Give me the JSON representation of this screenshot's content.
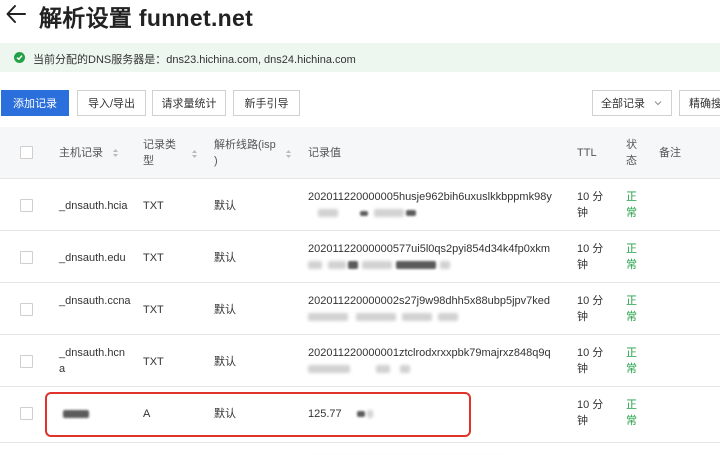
{
  "header": {
    "title": "解析设置 funnet.net"
  },
  "notice": {
    "text": "当前分配的DNS服务器是：dns23.hichina.com, dns24.hichina.com"
  },
  "toolbar": {
    "add_record": "添加记录",
    "import_export": "导入/导出",
    "request_stats": "请求量统计",
    "guide": "新手引导",
    "filter_select": "全部记录",
    "precise_search": "精确搜"
  },
  "table": {
    "headers": {
      "host": "主机记录",
      "type_l1": "记录类",
      "type_l2": "型",
      "line_l1": "解析线路(isp",
      "line_l2": ")",
      "value": "记录值",
      "ttl": "TTL",
      "status_l1": "状",
      "status_l2": "态",
      "remark": "备注"
    },
    "rows": [
      {
        "host": "_dnsauth.hcia",
        "type": "TXT",
        "line": "默认",
        "value_l1": "202011220000005husje962bih6uxuslkkbppmk98y",
        "ttl_l1": "10 分",
        "ttl_l2": "钟",
        "status_l1": "正",
        "status_l2": "常"
      },
      {
        "host": "_dnsauth.edu",
        "type": "TXT",
        "line": "默认",
        "value_l1": "20201122000000577ui5l0qs2pyi854d34k4fp0xkm",
        "ttl_l1": "10 分",
        "ttl_l2": "钟",
        "status_l1": "正",
        "status_l2": "常"
      },
      {
        "host": "_dnsauth.ccna",
        "type": "TXT",
        "line": "默认",
        "value_l1": "202011220000002s27j9w98dhh5x88ubp5jpv7ked",
        "ttl_l1": "10 分",
        "ttl_l2": "钟",
        "status_l1": "正",
        "status_l2": "常"
      },
      {
        "host": "_dnsauth.hcna",
        "type": "TXT",
        "line": "默认",
        "value_l1": "202011220000001ztclrodxrxxpbk79majrxz848q9q",
        "ttl_l1": "10 分",
        "ttl_l2": "钟",
        "status_l1": "正",
        "status_l2": "常"
      },
      {
        "host": "",
        "type": "A",
        "line": "默认",
        "value_l1": "125.77",
        "ttl_l1": "10 分",
        "ttl_l2": "钟",
        "status_l1": "正",
        "status_l2": "常"
      }
    ]
  },
  "colors": {
    "primary": "#2a6fdb",
    "success": "#24a148",
    "highlight": "#e0332b",
    "notice_bg": "#eef7ef"
  }
}
